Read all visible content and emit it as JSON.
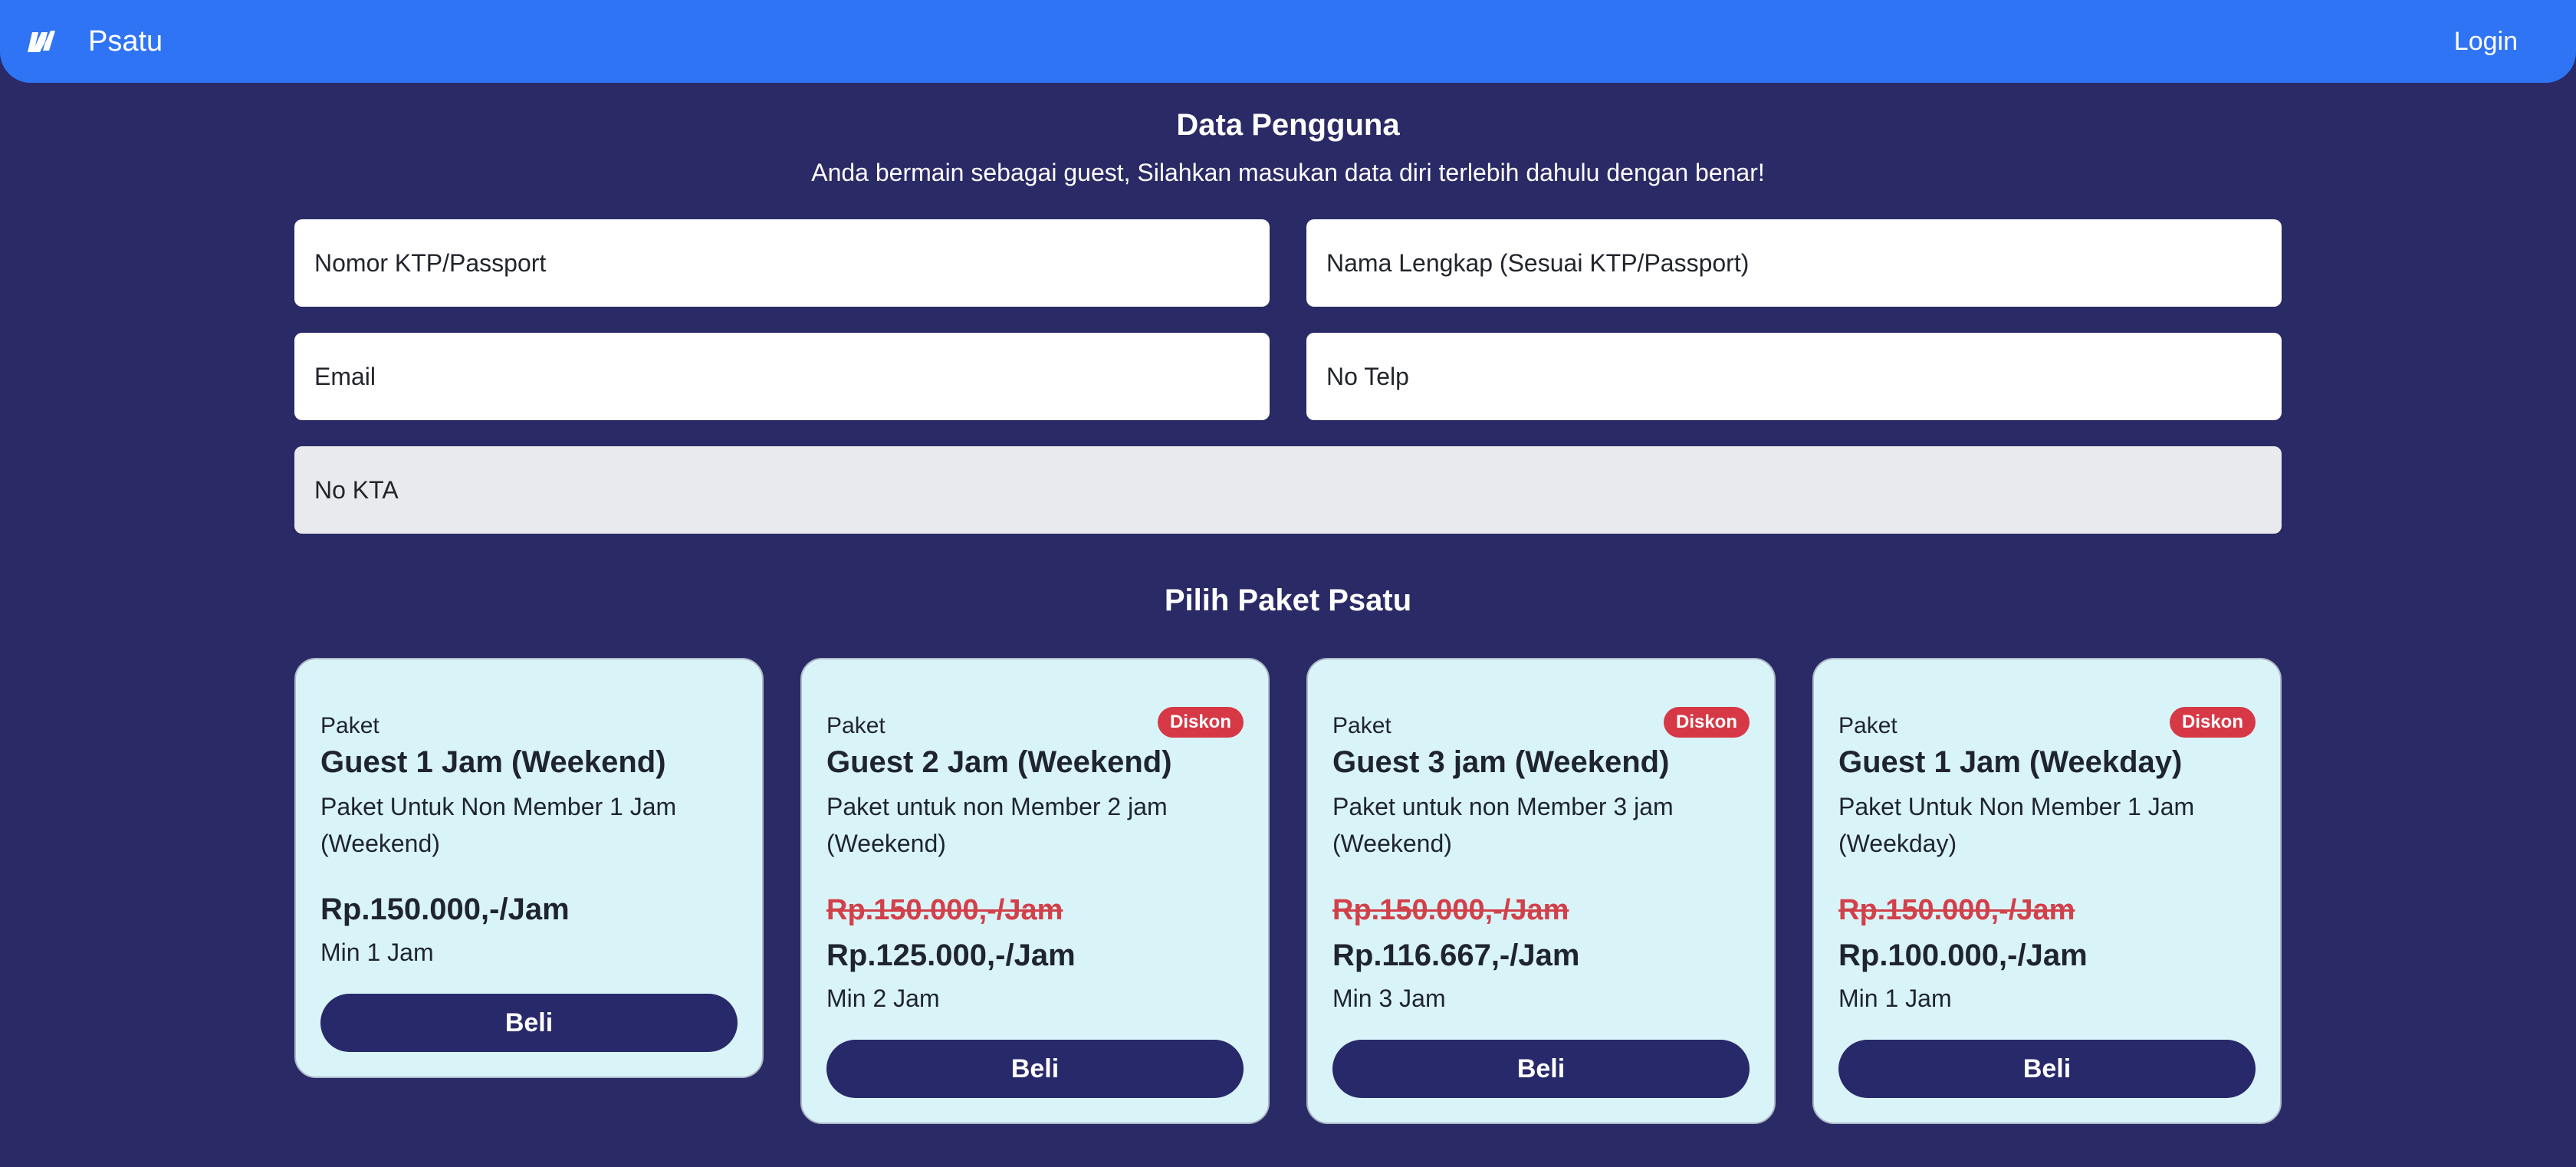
{
  "nav": {
    "brand": "Psatu",
    "login": "Login"
  },
  "form": {
    "title": "Data Pengguna",
    "subtitle": "Anda bermain sebagai guest, Silahkan masukan data diri terlebih dahulu dengan benar!",
    "ktp_placeholder": "Nomor KTP/Passport",
    "name_placeholder": "Nama Lengkap (Sesuai KTP/Passport)",
    "email_placeholder": "Email",
    "phone_placeholder": "No Telp",
    "kta_placeholder": "No KTA"
  },
  "packages": {
    "title": "Pilih Paket Psatu",
    "items": [
      {
        "label": "Paket",
        "name": "Guest 1 Jam (Weekend)",
        "desc": "Paket Untuk Non Member 1 Jam (Weekend)",
        "old_price": "",
        "price": "Rp.150.000,-/Jam",
        "min": "Min 1 Jam",
        "badge": "",
        "button": "Beli"
      },
      {
        "label": "Paket",
        "name": "Guest 2 Jam (Weekend)",
        "desc": "Paket untuk non Member 2 jam (Weekend)",
        "old_price": "Rp.150.000,-/Jam",
        "price": "Rp.125.000,-/Jam",
        "min": "Min 2 Jam",
        "badge": "Diskon",
        "button": "Beli"
      },
      {
        "label": "Paket",
        "name": "Guest 3 jam (Weekend)",
        "desc": "Paket untuk non Member 3 jam (Weekend)",
        "old_price": "Rp.150.000,-/Jam",
        "price": "Rp.116.667,-/Jam",
        "min": "Min 3 Jam",
        "badge": "Diskon",
        "button": "Beli"
      },
      {
        "label": "Paket",
        "name": "Guest 1 Jam (Weekday)",
        "desc": "Paket Untuk Non Member 1 Jam (Weekday)",
        "old_price": "Rp.150.000,-/Jam",
        "price": "Rp.100.000,-/Jam",
        "min": "Min 1 Jam",
        "badge": "Diskon",
        "button": "Beli"
      }
    ]
  },
  "colors": {
    "nav": "#2f74f5",
    "background": "#2a2a66",
    "card": "#d9f4f8",
    "button": "#28296a",
    "discount": "#d63846"
  }
}
